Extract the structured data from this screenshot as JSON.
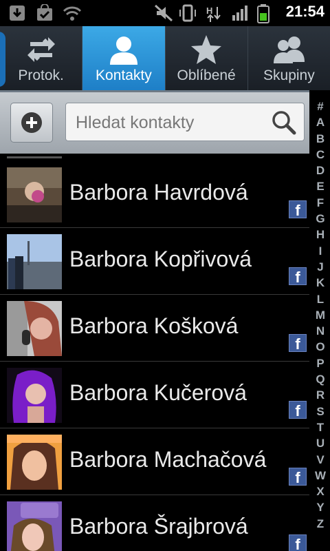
{
  "status_bar": {
    "time": "21:54",
    "icons": [
      "download-icon",
      "shopping-bag-icon",
      "wifi-icon",
      "mute-icon",
      "vibrate-icon",
      "hspa-data-icon",
      "signal-icon",
      "battery-icon"
    ],
    "signal_label": "H"
  },
  "tabs": [
    {
      "label": "Protok.",
      "icon": "swap-arrows-icon",
      "active": false
    },
    {
      "label": "Kontakty",
      "icon": "person-icon",
      "active": true
    },
    {
      "label": "Oblíbené",
      "icon": "star-icon",
      "active": false
    },
    {
      "label": "Skupiny",
      "icon": "group-icon",
      "active": false
    }
  ],
  "search": {
    "placeholder": "Hledat kontakty",
    "add_icon": "add-contact-icon",
    "search_icon": "search-icon"
  },
  "index_letters": [
    "#",
    "A",
    "B",
    "C",
    "D",
    "E",
    "F",
    "G",
    "H",
    "I",
    "J",
    "K",
    "L",
    "M",
    "N",
    "O",
    "P",
    "Q",
    "R",
    "S",
    "T",
    "U",
    "V",
    "W",
    "X",
    "Y",
    "Z"
  ],
  "contacts": [
    {
      "name": "Barbora Havrdová",
      "source": "facebook-icon"
    },
    {
      "name": "Barbora Kopřivová",
      "source": "facebook-icon"
    },
    {
      "name": "Barbora Košková",
      "source": "facebook-icon"
    },
    {
      "name": "Barbora Kučerová",
      "source": "facebook-icon"
    },
    {
      "name": "Barbora Machačová",
      "source": "facebook-icon"
    },
    {
      "name": "Barbora Šrajbrová",
      "source": "facebook-icon"
    }
  ],
  "facebook_glyph": "f",
  "colors": {
    "active_tab": "#2f97dc",
    "facebook": "#3b5998"
  }
}
